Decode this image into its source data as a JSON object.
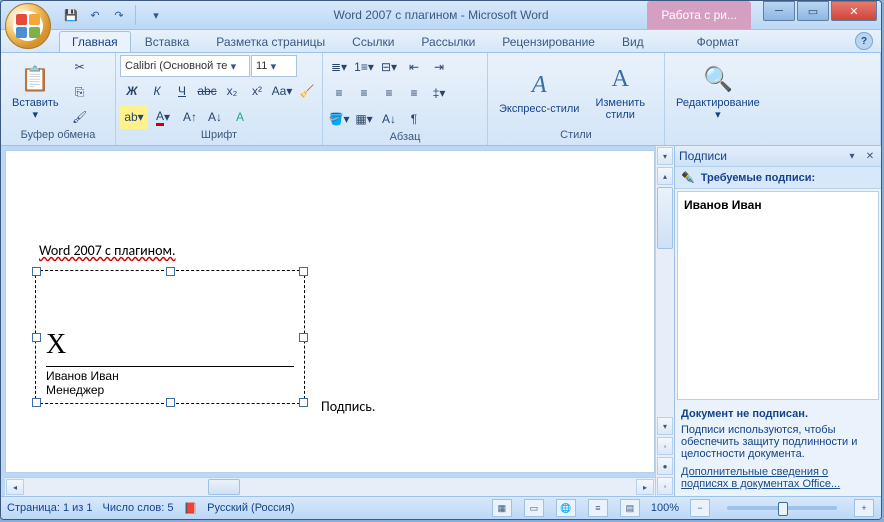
{
  "title": "Word 2007 с плагином - Microsoft Word",
  "context_tab": "Работа с ри...",
  "qa": {
    "save": "💾",
    "undo": "↶",
    "redo": "↷",
    "more": "▾"
  },
  "tabs": [
    "Главная",
    "Вставка",
    "Разметка страницы",
    "Ссылки",
    "Рассылки",
    "Рецензирование",
    "Вид",
    "Формат"
  ],
  "active_tab": 0,
  "ribbon": {
    "clipboard": {
      "label": "Буфер обмена",
      "paste": "Вставить"
    },
    "font": {
      "label": "Шрифт",
      "name": "Calibri (Основной те",
      "size": "11"
    },
    "paragraph": {
      "label": "Абзац"
    },
    "styles": {
      "label": "Стили",
      "quick": "Экспресс-стили",
      "change": "Изменить\nстили"
    },
    "editing": {
      "label": "",
      "btn": "Редактирование"
    }
  },
  "document": {
    "heading": "Word 2007 с плагином.",
    "sig_x": "X",
    "sig_name": "Иванов Иван",
    "sig_role": "Менеджер",
    "sig_caption": "Подпись."
  },
  "taskpane": {
    "title": "Подписи",
    "section": "Требуемые подписи:",
    "signer": "Иванов Иван",
    "unsigned": "Документ не подписан.",
    "desc": "Подписи используются, чтобы обеспечить защиту подлинности и целостности документа.",
    "link": "Дополнительные сведения о подписях в документах Office..."
  },
  "status": {
    "page": "Страница: 1 из 1",
    "words": "Число слов: 5",
    "lang": "Русский (Россия)",
    "zoom": "100%"
  }
}
